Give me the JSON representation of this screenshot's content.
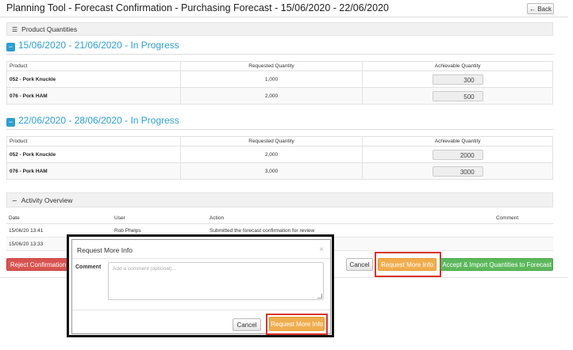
{
  "header": {
    "title": "Planning Tool - Forecast Confirmation - Purchasing Forecast - 15/06/2020 - 22/06/2020",
    "back_label": "← Back"
  },
  "product_quantities": {
    "heading": "Product Quantities",
    "weeks": [
      {
        "label": "15/06/2020 - 21/06/2020 - In Progress",
        "columns": [
          "Product",
          "Requested Quantity",
          "Achievable Quantity"
        ],
        "rows": [
          {
            "product": "052 - Pork Knuckle",
            "requested": "1,000",
            "achievable": "300"
          },
          {
            "product": "076 - Pork HAM",
            "requested": "2,000",
            "achievable": "500"
          }
        ]
      },
      {
        "label": "22/06/2020 - 28/06/2020 - In Progress",
        "columns": [
          "Product",
          "Requested Quantity",
          "Achievable Quantity"
        ],
        "rows": [
          {
            "product": "052 - Pork Knuckle",
            "requested": "2,000",
            "achievable": "2000"
          },
          {
            "product": "076 - Pork HAM",
            "requested": "3,000",
            "achievable": "3000"
          }
        ]
      }
    ]
  },
  "activity": {
    "heading": "Activity Overview",
    "columns": [
      "Date",
      "User",
      "Action",
      "Comment"
    ],
    "rows": [
      {
        "date": "15/06/20 13:41",
        "user": "Rob Phelps",
        "action": "Submitted the forecast confirmation for review",
        "comment": ""
      },
      {
        "date": "15/06/20 13:33",
        "user": "",
        "action": "",
        "comment": ""
      }
    ]
  },
  "footer": {
    "reject_label": "Reject Confirmation",
    "cancel_label": "Cancel",
    "request_info_label": "Request More Info",
    "accept_label": "Accept & Import Quantities to Forecast"
  },
  "modal": {
    "title": "Request More Info",
    "close_symbol": "×",
    "comment_label": "Comment",
    "comment_placeholder": "Add a comment (optional)...",
    "cancel_label": "Cancel",
    "submit_label": "Request More Info"
  },
  "colors": {
    "accent_blue": "#2a9fd6",
    "danger": "#d9534f",
    "warning": "#f0ad4e",
    "success": "#5cb85c",
    "highlight_box": "#d9342b"
  }
}
